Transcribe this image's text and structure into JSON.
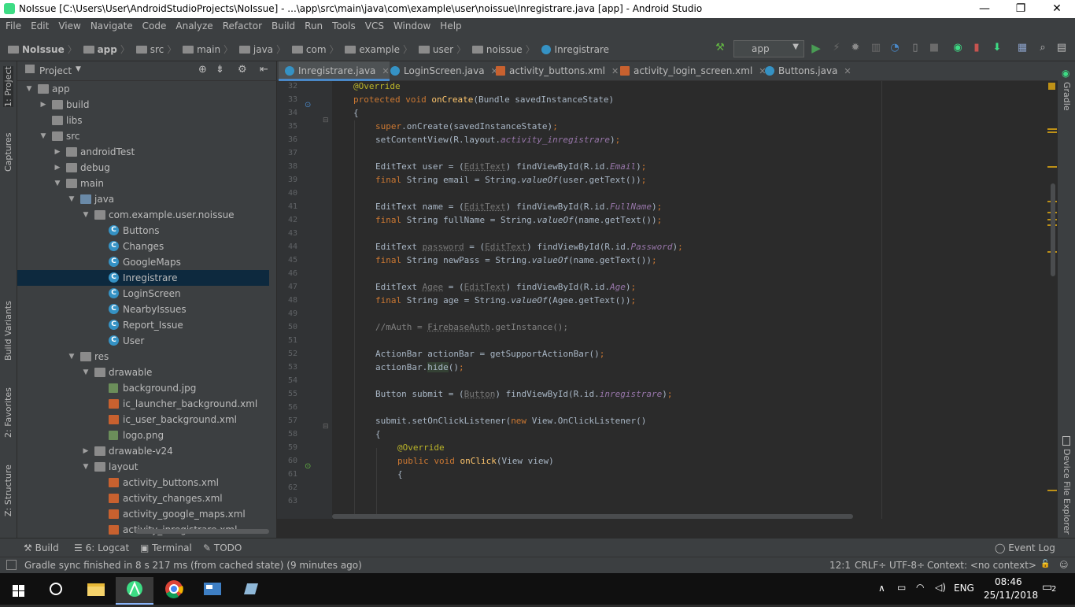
{
  "window": {
    "title": "NoIssue [C:\\Users\\User\\AndroidStudioProjects\\NoIssue] - ...\\app\\src\\main\\java\\com\\example\\user\\noissue\\Inregistrare.java [app] - Android Studio",
    "minimize": "—",
    "maximize": "❐",
    "close": "✕"
  },
  "menu": [
    "File",
    "Edit",
    "View",
    "Navigate",
    "Code",
    "Analyze",
    "Refactor",
    "Build",
    "Run",
    "Tools",
    "VCS",
    "Window",
    "Help"
  ],
  "breadcrumb": [
    "NoIssue",
    "app",
    "src",
    "main",
    "java",
    "com",
    "example",
    "user",
    "noissue",
    "Inregistrare"
  ],
  "run_config": "app",
  "left_tabs": {
    "project": "1: Project",
    "captures": "Captures",
    "build_variants": "Build Variants",
    "favorites": "2: Favorites",
    "structure": "Z: Structure"
  },
  "right_tabs": {
    "gradle": "Gradle",
    "device_explorer": "Device File Explorer"
  },
  "project_panel": {
    "title": "Project"
  },
  "tree": [
    {
      "label": "app",
      "type": "folder",
      "arrow": "▼"
    },
    {
      "label": "build",
      "type": "folder",
      "arrow": "▶"
    },
    {
      "label": "libs",
      "type": "folder",
      "arrow": ""
    },
    {
      "label": "src",
      "type": "folder",
      "arrow": "▼"
    },
    {
      "label": "androidTest",
      "type": "folder",
      "arrow": "▶"
    },
    {
      "label": "debug",
      "type": "folder",
      "arrow": "▶"
    },
    {
      "label": "main",
      "type": "folder",
      "arrow": "▼"
    },
    {
      "label": "java",
      "type": "src",
      "arrow": "▼"
    },
    {
      "label": "com.example.user.noissue",
      "type": "folder",
      "arrow": "▼"
    },
    {
      "label": "Buttons",
      "type": "class",
      "arrow": ""
    },
    {
      "label": "Changes",
      "type": "class",
      "arrow": ""
    },
    {
      "label": "GoogleMaps",
      "type": "class",
      "arrow": ""
    },
    {
      "label": "Inregistrare",
      "type": "class",
      "arrow": "",
      "selected": true
    },
    {
      "label": "LoginScreen",
      "type": "class",
      "arrow": ""
    },
    {
      "label": "NearbyIssues",
      "type": "class",
      "arrow": ""
    },
    {
      "label": "Report_Issue",
      "type": "class",
      "arrow": ""
    },
    {
      "label": "User",
      "type": "class",
      "arrow": ""
    },
    {
      "label": "res",
      "type": "folder",
      "arrow": "▼"
    },
    {
      "label": "drawable",
      "type": "folder",
      "arrow": "▼"
    },
    {
      "label": "background.jpg",
      "type": "img",
      "arrow": ""
    },
    {
      "label": "ic_launcher_background.xml",
      "type": "xml",
      "arrow": ""
    },
    {
      "label": "ic_user_background.xml",
      "type": "xml",
      "arrow": ""
    },
    {
      "label": "logo.png",
      "type": "img",
      "arrow": ""
    },
    {
      "label": "drawable-v24",
      "type": "folder",
      "arrow": "▶"
    },
    {
      "label": "layout",
      "type": "folder",
      "arrow": "▼"
    },
    {
      "label": "activity_buttons.xml",
      "type": "xml",
      "arrow": ""
    },
    {
      "label": "activity_changes.xml",
      "type": "xml",
      "arrow": ""
    },
    {
      "label": "activity_google_maps.xml",
      "type": "xml",
      "arrow": ""
    },
    {
      "label": "activity_inregistrare.xml",
      "type": "xml",
      "arrow": ""
    }
  ],
  "tabs": [
    {
      "label": "Inregistrare.java",
      "kind": "java",
      "active": true
    },
    {
      "label": "LoginScreen.java",
      "kind": "java",
      "active": false
    },
    {
      "label": "activity_buttons.xml",
      "kind": "xml",
      "active": false
    },
    {
      "label": "activity_login_screen.xml",
      "kind": "xml",
      "active": false
    },
    {
      "label": "Buttons.java",
      "kind": "java",
      "active": false
    }
  ],
  "line_numbers": [
    "32",
    "33",
    "34",
    "35",
    "36",
    "37",
    "38",
    "39",
    "40",
    "41",
    "42",
    "43",
    "44",
    "45",
    "46",
    "47",
    "48",
    "49",
    "50",
    "51",
    "52",
    "53",
    "54",
    "55",
    "56",
    "57",
    "58",
    "59",
    "60",
    "61",
    "62",
    "63"
  ],
  "code": [
    {
      "indent": 0,
      "parts": [
        [
          "an",
          "@Override"
        ]
      ]
    },
    {
      "indent": 0,
      "parts": [
        [
          "kw",
          "protected void "
        ],
        [
          "fn",
          "onCreate"
        ],
        [
          "",
          "(Bundle savedInstanceState)"
        ]
      ]
    },
    {
      "indent": 0,
      "parts": [
        [
          "",
          "{"
        ]
      ]
    },
    {
      "indent": 1,
      "parts": [
        [
          "kw",
          "super"
        ],
        [
          "",
          ".onCreate(savedInstanceState)"
        ],
        [
          "pu",
          ";"
        ]
      ]
    },
    {
      "indent": 1,
      "parts": [
        [
          "",
          "setContentView(R.layout."
        ],
        [
          "fld",
          "activity_inregistrare"
        ],
        [
          "",
          ")"
        ],
        [
          "pu",
          ";"
        ]
      ]
    },
    {
      "indent": 1,
      "parts": []
    },
    {
      "indent": 1,
      "parts": [
        [
          "",
          "EditText user = ("
        ],
        [
          "grey",
          "EditText"
        ],
        [
          "",
          ") findViewById(R.id."
        ],
        [
          "fld",
          "Email"
        ],
        [
          "",
          ")"
        ],
        [
          "pu",
          ";"
        ]
      ]
    },
    {
      "indent": 1,
      "parts": [
        [
          "kw",
          "final "
        ],
        [
          "",
          "String email = String."
        ],
        [
          "fn2",
          "valueOf"
        ],
        [
          "",
          "(user.getText())"
        ],
        [
          "pu",
          ";"
        ]
      ]
    },
    {
      "indent": 1,
      "parts": []
    },
    {
      "indent": 1,
      "parts": [
        [
          "",
          "EditText name = ("
        ],
        [
          "grey",
          "EditText"
        ],
        [
          "",
          ") findViewById(R.id."
        ],
        [
          "fld",
          "FullName"
        ],
        [
          "",
          ")"
        ],
        [
          "pu",
          ";"
        ]
      ]
    },
    {
      "indent": 1,
      "parts": [
        [
          "kw",
          "final "
        ],
        [
          "",
          "String fullName = String."
        ],
        [
          "fn2",
          "valueOf"
        ],
        [
          "",
          "(name.getText())"
        ],
        [
          "pu",
          ";"
        ]
      ]
    },
    {
      "indent": 1,
      "parts": []
    },
    {
      "indent": 1,
      "parts": [
        [
          "",
          "EditText "
        ],
        [
          "grey",
          "password"
        ],
        [
          "",
          " = ("
        ],
        [
          "grey",
          "EditText"
        ],
        [
          "",
          ") findViewById(R.id."
        ],
        [
          "fld",
          "Password"
        ],
        [
          "",
          ")"
        ],
        [
          "pu",
          ";"
        ]
      ]
    },
    {
      "indent": 1,
      "parts": [
        [
          "kw",
          "final "
        ],
        [
          "",
          "String newPass = String."
        ],
        [
          "fn2",
          "valueOf"
        ],
        [
          "",
          "(name.getText())"
        ],
        [
          "pu",
          ";"
        ]
      ]
    },
    {
      "indent": 1,
      "parts": []
    },
    {
      "indent": 1,
      "parts": [
        [
          "",
          "EditText "
        ],
        [
          "grey",
          "Agee"
        ],
        [
          "",
          " = ("
        ],
        [
          "grey",
          "EditText"
        ],
        [
          "",
          ") findViewById(R.id."
        ],
        [
          "fld",
          "Age"
        ],
        [
          "",
          ")"
        ],
        [
          "pu",
          ";"
        ]
      ]
    },
    {
      "indent": 1,
      "parts": [
        [
          "kw",
          "final "
        ],
        [
          "",
          "String age = String."
        ],
        [
          "fn2",
          "valueOf"
        ],
        [
          "",
          "(Agee.getText())"
        ],
        [
          "pu",
          ";"
        ]
      ]
    },
    {
      "indent": 1,
      "parts": []
    },
    {
      "indent": 1,
      "parts": [
        [
          "cm",
          "//mAuth = "
        ],
        [
          "cmu",
          "FirebaseAuth"
        ],
        [
          "cm",
          ".getInstance();"
        ]
      ]
    },
    {
      "indent": 1,
      "parts": []
    },
    {
      "indent": 1,
      "parts": [
        [
          "",
          "ActionBar actionBar = getSupportActionBar()"
        ],
        [
          "pu",
          ";"
        ]
      ]
    },
    {
      "indent": 1,
      "parts": [
        [
          "",
          "actionBar."
        ],
        [
          "hl",
          "hide"
        ],
        [
          "",
          "()"
        ],
        [
          "pu",
          ";"
        ]
      ]
    },
    {
      "indent": 1,
      "parts": []
    },
    {
      "indent": 1,
      "parts": [
        [
          "",
          "Button submit = ("
        ],
        [
          "grey",
          "Button"
        ],
        [
          "",
          ") findViewById(R.id."
        ],
        [
          "fld",
          "inregistrare"
        ],
        [
          "",
          ")"
        ],
        [
          "pu",
          ";"
        ]
      ]
    },
    {
      "indent": 1,
      "parts": []
    },
    {
      "indent": 1,
      "parts": [
        [
          "",
          "submit.setOnClickListener("
        ],
        [
          "kw",
          "new "
        ],
        [
          "",
          "View.OnClickListener()"
        ]
      ]
    },
    {
      "indent": 1,
      "parts": [
        [
          "",
          "{"
        ]
      ]
    },
    {
      "indent": 2,
      "parts": [
        [
          "an",
          "@Override"
        ]
      ]
    },
    {
      "indent": 2,
      "parts": [
        [
          "kw",
          "public void "
        ],
        [
          "fn",
          "onClick"
        ],
        [
          "",
          "(View view)"
        ]
      ]
    },
    {
      "indent": 2,
      "parts": [
        [
          "",
          "{"
        ]
      ]
    },
    {
      "indent": 2,
      "parts": []
    },
    {
      "indent": 2,
      "parts": []
    }
  ],
  "bottom_tabs": {
    "build": "Build",
    "logcat": "6: Logcat",
    "terminal": "Terminal",
    "todo": "TODO",
    "event_log": "Event Log"
  },
  "status": {
    "message": "Gradle sync finished in 8 s 217 ms (from cached state) (9 minutes ago)",
    "position": "12:1",
    "line_sep": "CRLF÷",
    "encoding": "UTF-8÷",
    "context": "Context: <no context>"
  },
  "taskbar": {
    "lang": "ENG",
    "time": "08:46",
    "date": "25/11/2018",
    "notifications": "2"
  },
  "colors": {
    "accent": "#4a88c7",
    "selection": "#0d293e",
    "android_green": "#3ddc84"
  }
}
